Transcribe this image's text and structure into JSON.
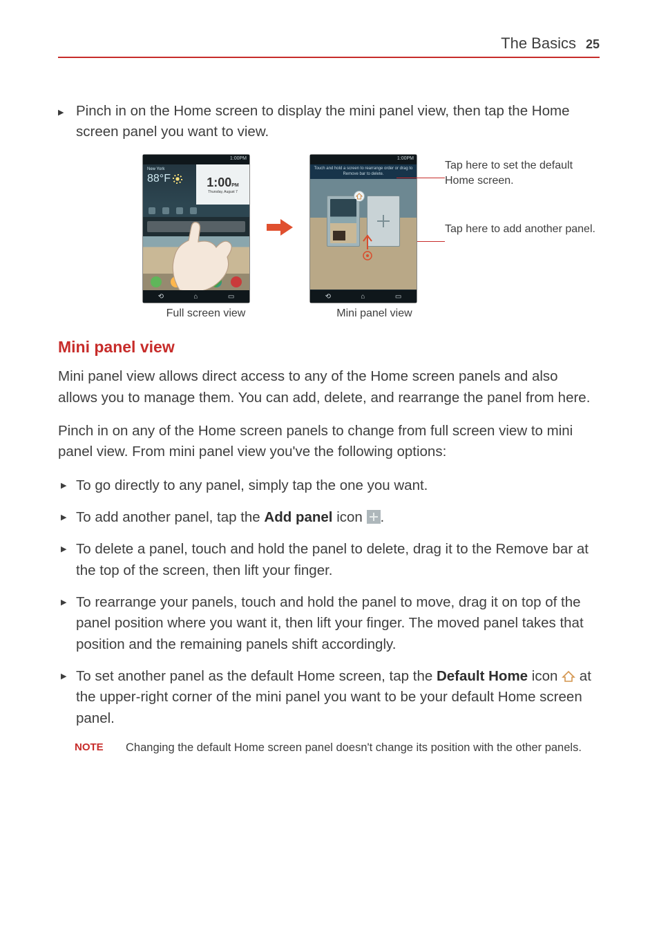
{
  "header": {
    "section": "The Basics",
    "page_number": "25"
  },
  "intro_bullet": "Pinch in on the Home screen to display the mini panel view, then tap the Home screen panel you want to view.",
  "phone_left": {
    "status_time": "1:00PM",
    "city": "New York",
    "temp": "88°F",
    "clock_time": "1:00",
    "clock_suffix": "PM",
    "clock_date": "Thursday, August 7"
  },
  "phone_right": {
    "tip": "Touch and hold a screen to rearrange order or drag to Remove bar to delete."
  },
  "captions": {
    "left": "Full screen view",
    "right": "Mini panel view"
  },
  "annotations": {
    "a1": "Tap here to set the default Home screen.",
    "a2": "Tap here to add another panel."
  },
  "section_title": "Mini panel view",
  "para1": "Mini panel view allows direct access to any of the Home screen panels and also allows you to manage them. You can add, delete, and rearrange the panel from here.",
  "para2": "Pinch in on any of the Home screen panels to change from full screen view to mini panel view. From mini panel view you've the following options:",
  "bullets": {
    "b1": "To go directly to any panel, simply tap the one you want.",
    "b2_a": "To add another panel, tap the ",
    "b2_bold": "Add panel",
    "b2_b": " icon ",
    "b2_c": ".",
    "b3": "To delete a panel, touch and hold the panel to delete, drag it to the Remove bar at the top of the screen, then lift your finger.",
    "b4": "To rearrange your panels, touch and hold the panel to move, drag it on top of the panel position where you want it, then lift your finger. The moved panel takes that position and the remaining panels shift accordingly.",
    "b5_a": "To set another panel as the default Home screen, tap the ",
    "b5_bold": "Default Home",
    "b5_b": " icon ",
    "b5_c": " at the upper-right corner of the mini panel you want to be your default Home screen panel."
  },
  "note": {
    "label": "NOTE",
    "text": "Changing the default Home screen panel doesn't change its position with the other panels."
  }
}
